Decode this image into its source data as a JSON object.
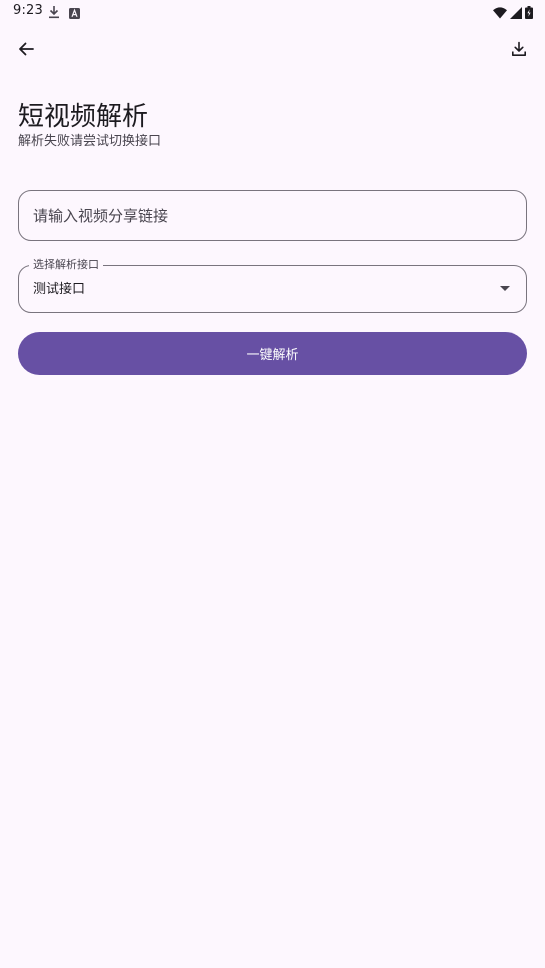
{
  "status_bar": {
    "time": "9:23",
    "icons": [
      "download-notification-icon",
      "a-badge-icon",
      "wifi-icon",
      "signal-icon",
      "battery-icon"
    ]
  },
  "app_bar": {
    "back_icon": "arrow-back-icon",
    "action_icon": "download-icon"
  },
  "header": {
    "title": "短视频解析",
    "subtitle": "解析失败请尝试切换接口"
  },
  "url_field": {
    "value": "",
    "placeholder": "请输入视频分享链接"
  },
  "api_select": {
    "label": "选择解析接口",
    "selected": "测试接口"
  },
  "parse_button": {
    "label": "一键解析"
  },
  "colors": {
    "background": "#fdf7fe",
    "primary": "#6750a4",
    "outline": "#79747e",
    "on_surface": "#1d1b20",
    "on_surface_variant": "#49454f"
  }
}
